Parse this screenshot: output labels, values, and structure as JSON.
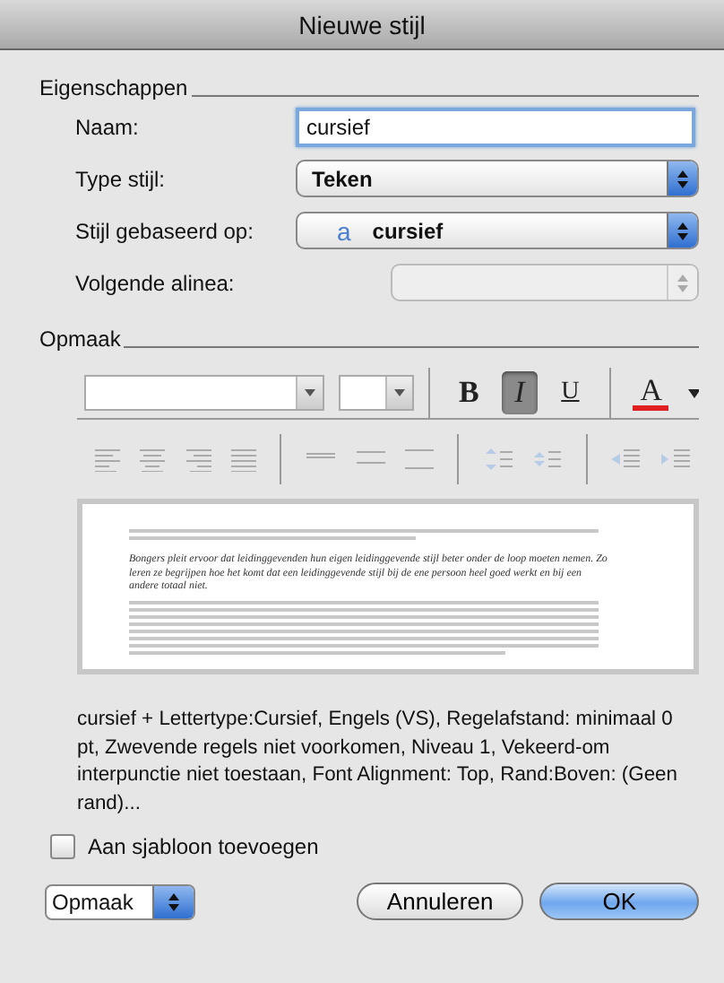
{
  "window": {
    "title": "Nieuwe stijl"
  },
  "properties": {
    "heading": "Eigenschappen",
    "fields": [
      {
        "kind": "text",
        "label": "Naam:",
        "value": "cursief"
      },
      {
        "kind": "select",
        "label": "Type stijl:",
        "value": "Teken",
        "disabled": false
      },
      {
        "kind": "select",
        "label": "Stijl gebaseerd op:",
        "value": "cursief",
        "icon_char": "a",
        "disabled": false
      },
      {
        "kind": "select",
        "label": "Volgende alinea:",
        "disabled": true
      }
    ]
  },
  "format": {
    "heading": "Opmaak",
    "style_buttons": [
      {
        "label": "B",
        "kind": "bold",
        "selected": false
      },
      {
        "label": "I",
        "kind": "italic",
        "selected": true
      },
      {
        "label": "U",
        "kind": "underline",
        "selected": false
      }
    ],
    "color_button": {
      "label": "A",
      "color": "#e02020"
    },
    "paragraph_buttons": {
      "disabled": true
    }
  },
  "preview": {
    "sample": "Bongers pleit ervoor dat leidinggevenden hun eigen leidinggevende stijl beter onder de loop moeten nemen. Zo leren ze begrijpen hoe het komt dat een leidinggevende stijl bij de ene persoon heel goed werkt en bij een andere totaal niet."
  },
  "description": "cursief + Lettertype:Cursief, Engels (VS), Regelafstand: minimaal 0 pt, Zwevende regels niet voorkomen, Niveau 1, Vekeerd-om interpunctie niet toestaan, Font Alignment: Top, Rand:Boven: (Geen rand)...",
  "template_checkbox": {
    "label": "Aan sjabloon toevoegen",
    "checked": false
  },
  "footer": {
    "menu": "Opmaak",
    "buttons": [
      {
        "label": "Annuleren",
        "kind": "cancel"
      },
      {
        "label": "OK",
        "kind": "default"
      }
    ]
  }
}
